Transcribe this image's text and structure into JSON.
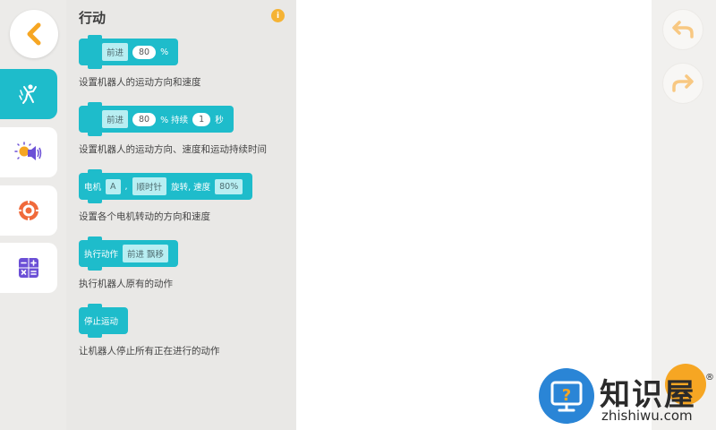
{
  "palette": {
    "title": "行动",
    "info_icon": "i"
  },
  "blocks": [
    {
      "segments": [
        {
          "kind": "rect",
          "text": "前进"
        },
        {
          "kind": "pill",
          "text": "80"
        },
        {
          "kind": "unit",
          "text": "%"
        }
      ],
      "description": "设置机器人的运动方向和速度"
    },
    {
      "segments": [
        {
          "kind": "rect",
          "text": "前进"
        },
        {
          "kind": "pill",
          "text": "80"
        },
        {
          "kind": "unit",
          "text": "%  持续"
        },
        {
          "kind": "pill",
          "text": "1"
        },
        {
          "kind": "unit",
          "text": "秒"
        }
      ],
      "description": "设置机器人的运动方向、速度和运动持续时间"
    },
    {
      "segments": [
        {
          "kind": "label",
          "text": "电机"
        },
        {
          "kind": "rect",
          "text": "A"
        },
        {
          "kind": "unit",
          "text": ","
        },
        {
          "kind": "rect",
          "text": "顺时针"
        },
        {
          "kind": "unit",
          "text": "旋转, 速度"
        },
        {
          "kind": "rect",
          "text": "80%"
        }
      ],
      "description": "设置各个电机转动的方向和速度"
    },
    {
      "segments": [
        {
          "kind": "label",
          "text": "执行动作"
        },
        {
          "kind": "rect",
          "text": "前进 飘移"
        }
      ],
      "description": "执行机器人原有的动作"
    },
    {
      "segments": [
        {
          "kind": "label",
          "text": "停止运动"
        }
      ],
      "description": "让机器人停止所有正在进行的动作"
    }
  ],
  "categories": [
    {
      "icon": "motion-figure-icon",
      "active": true
    },
    {
      "icon": "light-sound-icon",
      "active": false
    },
    {
      "icon": "sensor-icon",
      "active": false
    },
    {
      "icon": "calculator-icon",
      "active": false
    }
  ],
  "toolbar": {
    "back_icon": "chevron-left-icon",
    "undo_icon": "undo-icon",
    "redo_icon": "redo-icon"
  },
  "watermark": {
    "title": "知识屋",
    "subtitle": "zhishiwu.com",
    "registered": "®"
  },
  "colors": {
    "accent": "#1ebccb",
    "orange": "#f5a623",
    "purple": "#6b4fd6"
  }
}
